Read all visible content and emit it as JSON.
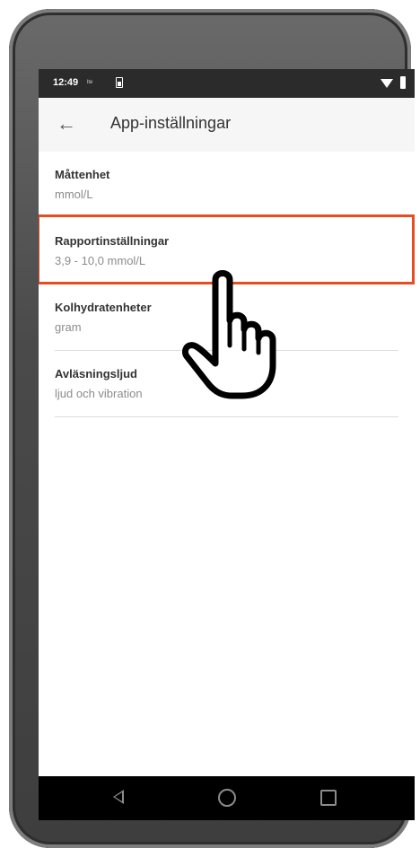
{
  "status_bar": {
    "time": "12:49",
    "mini_text": "lte",
    "icons": [
      "battery-icon",
      "wifi-icon",
      "battery-icon"
    ]
  },
  "toolbar": {
    "back_icon": "arrow-left-icon",
    "title": "App-inställningar"
  },
  "settings": [
    {
      "title": "Måttenhet",
      "subtitle": "mmol/L"
    },
    {
      "title": "Rapportinställningar",
      "subtitle": "3,9 - 10,0 mmol/L"
    },
    {
      "title": "Kolhydratenheter",
      "subtitle": "gram"
    },
    {
      "title": "Avläsningsljud",
      "subtitle": "ljud och vibration"
    }
  ],
  "highlight_color": "#e54d22",
  "pointer": {
    "icon": "hand-pointer-icon"
  },
  "navbar": {
    "icons": [
      "back-triangle-icon",
      "home-circle-icon",
      "recents-square-icon"
    ]
  }
}
